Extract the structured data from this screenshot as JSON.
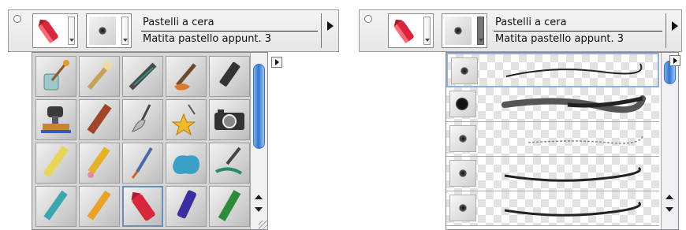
{
  "left_panel": {
    "tool_name": "Pastelli a cera",
    "preset_name": "Matita pastello appunt. 3",
    "tool_icon": "red-crayon-icon",
    "tip_icon": "brush-tip-dot-icon",
    "menu_arrow_icon": "triangle-right-icon",
    "grid_icons": [
      [
        "water-glass-brush-icon",
        "flat-brush-icon",
        "airbrush-icon",
        "paint-tube-brush-icon",
        "marker-icon"
      ],
      [
        "stamp-icon",
        "chalk-icon",
        "palette-knife-icon",
        "star-sparkle-icon",
        "camera-icon"
      ],
      [
        "yellow-pencil-icon",
        "colored-pencil-icon",
        "fine-brush-icon",
        "blue-cloud-blob-icon",
        "ink-pen-icon"
      ],
      [
        "teal-pencil-icon",
        "orange-pencil-icon",
        "red-crayon-icon",
        "purple-felt-pen-icon",
        "green-marker-icon"
      ]
    ]
  },
  "right_panel": {
    "tool_name": "Pastelli a cera",
    "preset_name": "Matita pastello appunt. 3",
    "tool_icon": "red-crayon-icon",
    "tip_icon": "brush-tip-dot-icon",
    "menu_arrow_icon": "triangle-right-icon",
    "rows": [
      {
        "tip": "soft-dot-icon",
        "stroke": "thin-stroke"
      },
      {
        "tip": "rough-blob-icon",
        "stroke": "thick-stroke"
      },
      {
        "tip": "soft-dot-icon",
        "stroke": "faint-stroke"
      },
      {
        "tip": "soft-dot-icon",
        "stroke": "medium-stroke"
      },
      {
        "tip": "soft-dot-icon",
        "stroke": "medium-stroke"
      }
    ]
  },
  "colors": {
    "selection_blue": "#6b8fb8",
    "scroll_blue": "#2f74d0",
    "crayon_red": "#d8263c"
  }
}
